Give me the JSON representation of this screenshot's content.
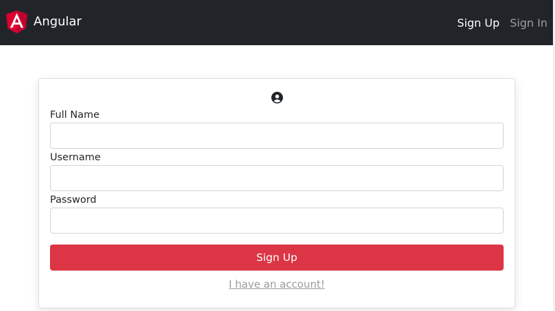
{
  "navbar": {
    "brand": "Angular",
    "links": [
      {
        "label": "Sign Up",
        "active": true
      },
      {
        "label": "Sign In",
        "active": false
      }
    ]
  },
  "form": {
    "icon": "user-circle-icon",
    "fields": [
      {
        "label": "Full Name",
        "value": "",
        "placeholder": ""
      },
      {
        "label": "Username",
        "value": "",
        "placeholder": ""
      },
      {
        "label": "Password",
        "value": "",
        "placeholder": ""
      }
    ],
    "submit_label": "Sign Up",
    "account_link": "I have an account!"
  },
  "colors": {
    "navbar_bg": "#212529",
    "brand_red": "#dd0031",
    "submit_bg": "#dc3545",
    "link_muted": "#9a9a9a"
  }
}
